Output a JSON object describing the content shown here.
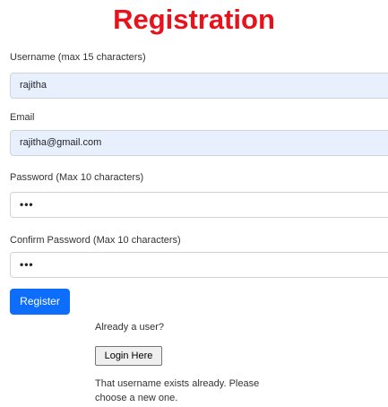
{
  "page": {
    "title": "Registration"
  },
  "form": {
    "username": {
      "label": "Username (max 15 characters)",
      "value": "rajitha"
    },
    "email": {
      "label": "Email",
      "value": "rajitha@gmail.com"
    },
    "password": {
      "label": "Password (Max 10 characters)",
      "value": "•••"
    },
    "confirm_password": {
      "label": "Confirm Password (Max 10 characters)",
      "value": "•••"
    },
    "register_label": "Register"
  },
  "login": {
    "prompt": "Already a user?",
    "button_label": "Login Here"
  },
  "messages": {
    "error": "That username exists already. Please choose a new one."
  },
  "colors": {
    "title": "#e8121b",
    "primary_button": "#0d6efd",
    "autofill_background": "#e8f0fe"
  }
}
